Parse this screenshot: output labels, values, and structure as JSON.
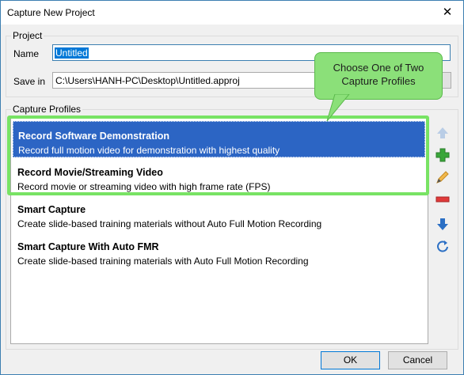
{
  "window": {
    "title": "Capture New Project",
    "close_glyph": "✕"
  },
  "project": {
    "legend": "Project",
    "name_label": "Name",
    "name_value": "Untitled",
    "savein_label": "Save in",
    "savein_value": "C:\\Users\\HANH-PC\\Desktop\\Untitled.approj"
  },
  "profiles": {
    "legend": "Capture Profiles",
    "items": [
      {
        "title": "Record Software Demonstration",
        "desc": "Record full motion video for demonstration with highest quality",
        "selected": true
      },
      {
        "title": "Record Movie/Streaming Video",
        "desc": "Record movie or streaming video with high frame rate (FPS)",
        "selected": false
      },
      {
        "title": "Smart Capture",
        "desc": "Create slide-based training materials without Auto Full Motion Recording",
        "selected": false
      },
      {
        "title": "Smart Capture With Auto FMR",
        "desc": "Create slide-based training materials with Auto Full Motion Recording",
        "selected": false
      }
    ]
  },
  "callout": {
    "line1": "Choose One of Two",
    "line2": "Capture Profiles"
  },
  "side_buttons": [
    "move-up-icon",
    "add-icon",
    "edit-icon",
    "remove-icon",
    "move-down-icon",
    "reset-icon"
  ],
  "buttons": {
    "ok": "OK",
    "cancel": "Cancel"
  },
  "colors": {
    "selection": "#2c65c4",
    "highlight": "#78e364",
    "callout": "#8be079"
  }
}
